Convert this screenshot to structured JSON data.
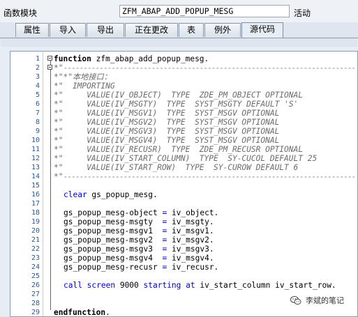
{
  "header": {
    "module_label": "函数模块",
    "module_name": "ZFM_ABAP_ADD_POPUP_MESG",
    "status": "活动"
  },
  "tabs": [
    {
      "label": "属性"
    },
    {
      "label": "导入"
    },
    {
      "label": "导出"
    },
    {
      "label": "正在更改"
    },
    {
      "label": "表"
    },
    {
      "label": "例外"
    },
    {
      "label": "源代码",
      "active": true
    }
  ],
  "editor": {
    "line_numbers": [
      "1",
      "2",
      "3",
      "4",
      "5",
      "6",
      "7",
      "8",
      "9",
      "10",
      "11",
      "12",
      "13",
      "14",
      "15",
      "16",
      "17",
      "18",
      "19",
      "20",
      "21",
      "22",
      "23",
      "24",
      "25",
      "26",
      "27",
      "28",
      "29"
    ],
    "kw_function": "function",
    "fn_name": " zfm_abap_add_popup_mesg.",
    "comment_header": "*\"",
    "comment_dash": "-------------------------------------------------------------------------",
    "comments": [
      "*\"*\"本地接口：",
      "*\"  IMPORTING",
      "*\"     VALUE(IV_OBJECT)  TYPE  ZDE_PM_OBJECT OPTIONAL",
      "*\"     VALUE(IV_MSGTY)  TYPE  SYST_MSGTY DEFAULT 'S'",
      "*\"     VALUE(IV_MSGV1)  TYPE  SYST_MSGV OPTIONAL",
      "*\"     VALUE(IV_MSGV2)  TYPE  SYST_MSGV OPTIONAL",
      "*\"     VALUE(IV_MSGV3)  TYPE  SYST_MSGV OPTIONAL",
      "*\"     VALUE(IV_MSGV4)  TYPE  SYST_MSGV OPTIONAL",
      "*\"     VALUE(IV_RECUSR)  TYPE  ZDE_PM_RECUSR OPTIONAL",
      "*\"     VALUE(IV_START_COLUMN)  TYPE  SY-CUCOL DEFAULT 25",
      "*\"     VALUE(IV_START_ROW)  TYPE  SY-CUROW DEFAULT 6"
    ],
    "kw_clear": "clear",
    "clear_target": " gs_popup_mesg.",
    "assign_lhs": [
      "gs_popup_mesg-object",
      "gs_popup_mesg-msgty",
      "gs_popup_mesg-msgv1",
      "gs_popup_mesg-msgv2",
      "gs_popup_mesg-msgv3",
      "gs_popup_mesg-msgv4",
      "gs_popup_mesg-recusr"
    ],
    "assign_pad": [
      "",
      " ",
      " ",
      " ",
      " ",
      " ",
      ""
    ],
    "assign_op": " = ",
    "assign_rhs": [
      "iv_object.",
      "iv_msgty.",
      "iv_msgv1.",
      "iv_msgv2.",
      "iv_msgv3.",
      "iv_msgv4.",
      "iv_recusr."
    ],
    "kw_call": "call screen",
    "screen_no": " 9000 ",
    "kw_starting": "starting at",
    "call_args": " iv_start_column iv_start_row.",
    "kw_endfunction": "endfunction",
    "end_dot": "."
  },
  "watermark": {
    "text": "李斌的笔记",
    "icon": "wechat-icon"
  }
}
